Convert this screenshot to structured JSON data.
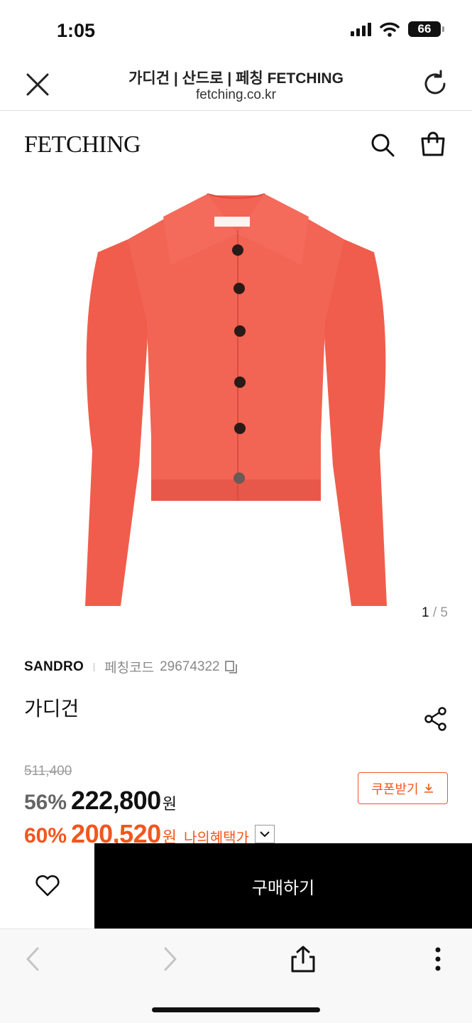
{
  "status_bar": {
    "time": "1:05",
    "battery": "66"
  },
  "browser": {
    "page_title": "가디건 | 산드로 | 페칭 FETCHING",
    "url": "fetching.co.kr"
  },
  "site": {
    "logo": "FETCHING"
  },
  "gallery": {
    "current": "1",
    "separator": " / ",
    "total": "5",
    "garment_color": "#f26453"
  },
  "product": {
    "brand": "SANDRO",
    "code_label": "페칭코드",
    "code": "29674322",
    "name": "가디건"
  },
  "pricing": {
    "original": "511,400",
    "discount1": "56%",
    "price1": "222,800",
    "won": "원",
    "discount2": "60%",
    "price2": "200,520",
    "benefit_label": "나의혜택가",
    "coupon_label": "쿠폰받기"
  },
  "actions": {
    "buy_label": "구매하기"
  },
  "colors": {
    "accent": "#f2561d",
    "buy_bg": "#000000"
  },
  "icons": [
    "close-icon",
    "reload-icon",
    "search-icon",
    "bag-icon",
    "copy-icon",
    "share-icon",
    "download-icon",
    "chevron-down-icon",
    "heart-icon",
    "back-icon",
    "forward-icon",
    "share-upload-icon",
    "more-icon"
  ]
}
